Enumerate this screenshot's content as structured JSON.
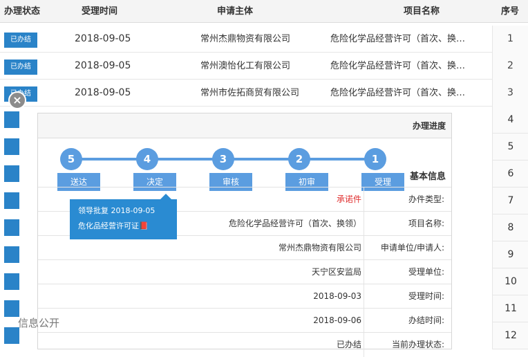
{
  "table": {
    "headers": {
      "status": "办理状态",
      "date": "受理时间",
      "applicant": "申请主体",
      "item": "项目名称",
      "index": "序号"
    },
    "rows": [
      {
        "status": "已办结",
        "date": "2018-09-05",
        "applicant": "常州杰鼎物资有限公司",
        "item": "危险化学品经营许可（首次、换…",
        "index": "1"
      },
      {
        "status": "已办结",
        "date": "2018-09-05",
        "applicant": "常州澳怡化工有限公司",
        "item": "危险化学品经营许可（首次、换…",
        "index": "2"
      },
      {
        "status": "已办结",
        "date": "2018-09-05",
        "applicant": "常州市佐拓商贸有限公司",
        "item": "危险化学品经营许可（首次、换…",
        "index": "3"
      }
    ],
    "more_indices": [
      "4",
      "5",
      "6",
      "7",
      "8",
      "9",
      "10",
      "11",
      "12"
    ]
  },
  "close_icon_glyph": "×",
  "panel": {
    "title": "办理进度",
    "steps": [
      {
        "num": "1",
        "label": "受理"
      },
      {
        "num": "2",
        "label": "初审"
      },
      {
        "num": "3",
        "label": "审核"
      },
      {
        "num": "4",
        "label": "决定"
      },
      {
        "num": "5",
        "label": "送达"
      }
    ],
    "tooltip": {
      "line1": "领导批复 2018-09-05",
      "line2": "危化品经营许可证📕"
    },
    "section_title": "基本信息",
    "info": [
      {
        "label": "办件类型:",
        "value": "承诺件",
        "accent": true
      },
      {
        "label": "项目名称:",
        "value": "危险化学品经营许可（首次、换领）"
      },
      {
        "label": "申请单位/申请人:",
        "value": "常州杰鼎物资有限公司"
      },
      {
        "label": "受理单位:",
        "value": "天宁区安监局"
      },
      {
        "label": "受理时间:",
        "value": "2018-09-03"
      },
      {
        "label": "办结时间:",
        "value": "2018-09-06"
      },
      {
        "label": "当前办理状态:",
        "value": "已办结"
      }
    ]
  },
  "watermark": "信息公开",
  "colors": {
    "accent": "#2a83c8",
    "step": "#5b9de0",
    "red": "#e03030"
  }
}
